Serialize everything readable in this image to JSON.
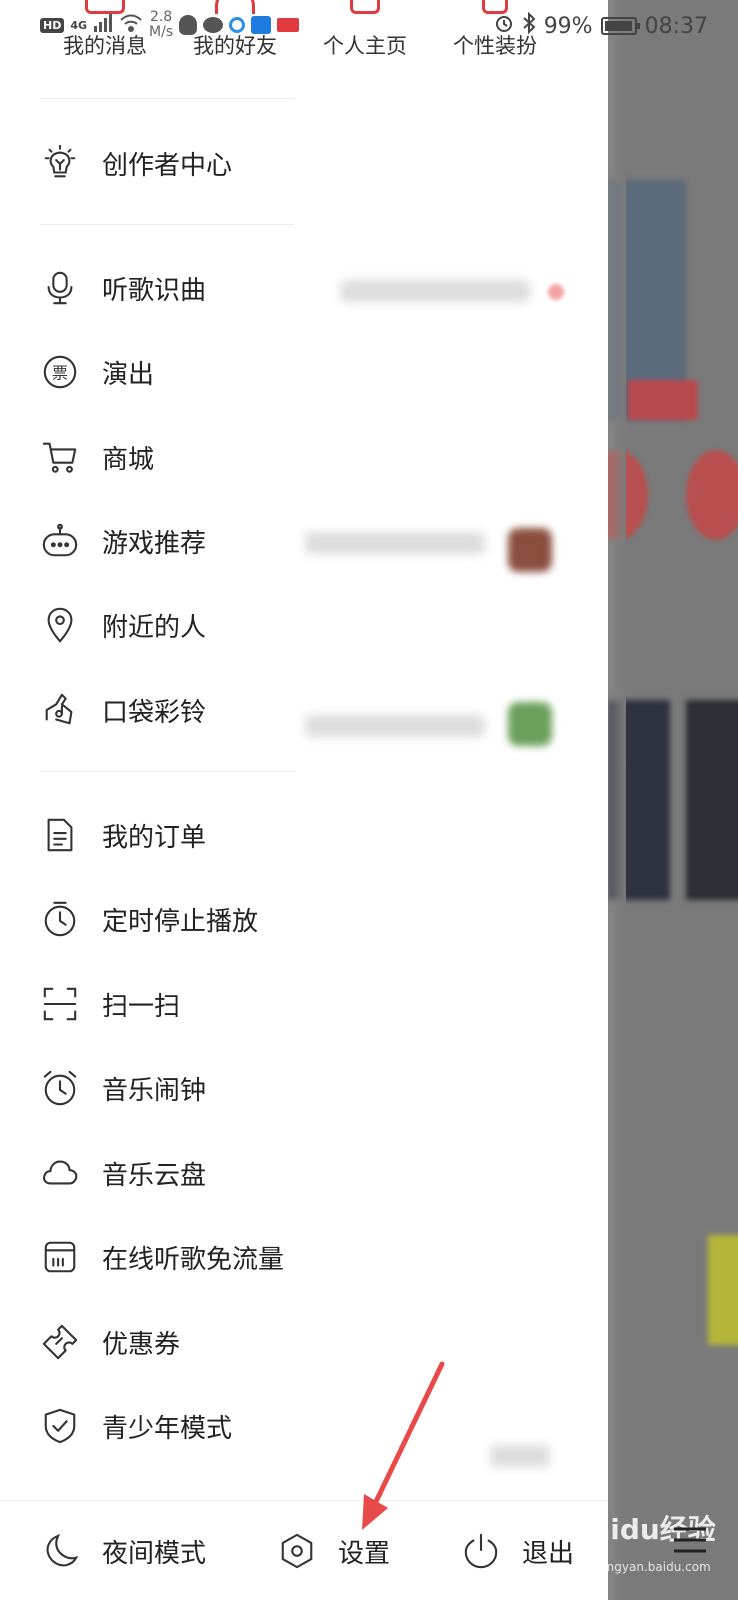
{
  "status_bar": {
    "network": "4G",
    "speed_value": "2.8",
    "speed_unit": "M/s",
    "battery": "99%",
    "time": "08:37",
    "hd_badge": "HD"
  },
  "quick_row": [
    {
      "label": "我的消息",
      "icon": "message-icon"
    },
    {
      "label": "我的好友",
      "icon": "friends-icon"
    },
    {
      "label": "个人主页",
      "icon": "profile-icon"
    },
    {
      "label": "个性装扮",
      "icon": "skin-icon"
    }
  ],
  "creator": {
    "label": "创作者中心",
    "icon": "lightbulb-icon"
  },
  "group1": [
    {
      "label": "听歌识曲",
      "icon": "microphone-icon"
    },
    {
      "label": "演出",
      "icon": "ticket-icon"
    },
    {
      "label": "商城",
      "icon": "cart-icon"
    },
    {
      "label": "游戏推荐",
      "icon": "gamepad-icon"
    },
    {
      "label": "附近的人",
      "icon": "location-pin-icon"
    },
    {
      "label": "口袋彩铃",
      "icon": "music-note-icon"
    }
  ],
  "group2": [
    {
      "label": "我的订单",
      "icon": "order-icon"
    },
    {
      "label": "定时停止播放",
      "icon": "timer-icon"
    },
    {
      "label": "扫一扫",
      "icon": "scan-icon"
    },
    {
      "label": "音乐闹钟",
      "icon": "alarm-icon"
    },
    {
      "label": "音乐云盘",
      "icon": "cloud-icon"
    },
    {
      "label": "在线听歌免流量",
      "icon": "sim-card-icon"
    },
    {
      "label": "优惠券",
      "icon": "coupon-icon"
    },
    {
      "label": "青少年模式",
      "icon": "shield-icon"
    }
  ],
  "bottom_bar": {
    "night_mode": "夜间模式",
    "settings": "设置",
    "logout": "退出"
  },
  "watermark": {
    "text": "Baidu经验",
    "sub": "jingyan.baidu.com"
  },
  "colors": {
    "accent": "#e0393e",
    "arrow": "#e84a4a",
    "overlay": "#7a7a7a"
  }
}
